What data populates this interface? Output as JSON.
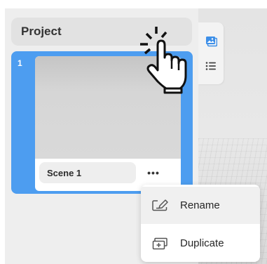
{
  "project": {
    "title": "Project"
  },
  "scene_card": {
    "index": "1",
    "name": "Scene 1",
    "more_icon": "ellipsis-icon",
    "more_label": "•••",
    "selected": true
  },
  "side_tabs": [
    {
      "name": "images",
      "icon": "image-icon"
    },
    {
      "name": "list",
      "icon": "list-icon"
    }
  ],
  "context_menu": {
    "items": [
      {
        "label": "Rename",
        "icon": "rename-icon",
        "hovered": true
      },
      {
        "label": "Duplicate",
        "icon": "duplicate-icon",
        "hovered": false
      }
    ]
  },
  "colors": {
    "accent": "#4d9df0",
    "panel": "#eeeeee",
    "header": "#e2e2e2"
  },
  "cursor": "pointing-hand-icon"
}
